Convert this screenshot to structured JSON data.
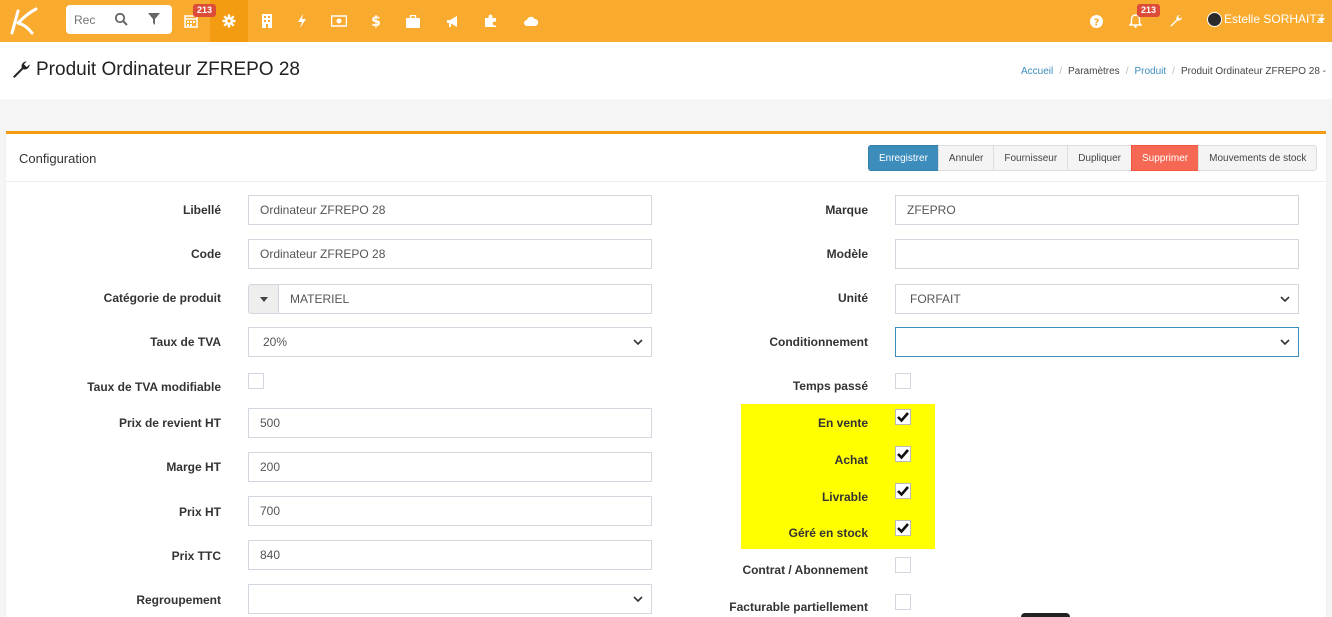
{
  "navbar": {
    "search_placeholder": "Rec",
    "calendar_badge": "213",
    "notifications_badge": "213",
    "user_name": "Estelle SORHAITZ",
    "colors": {
      "bar": "#f9ab2f",
      "active": "#f39c12",
      "badge": "#dd4b39"
    },
    "icons": [
      "logo-icon",
      "search-icon",
      "filter-icon",
      "calendar-icon",
      "gear-icon",
      "building-icon",
      "bolt-icon",
      "money-icon",
      "dollar-icon",
      "briefcase-icon",
      "megaphone-icon",
      "puzzle-icon",
      "cloud-icon",
      "help-icon",
      "bell-icon",
      "wrench-icon",
      "caret-down-icon"
    ]
  },
  "page": {
    "title": "Produit Ordinateur ZFREPO 28",
    "breadcrumb": {
      "home": "Accueil",
      "settings": "Paramètres",
      "product": "Produit",
      "current": "Produit Ordinateur ZFREPO 28 -"
    }
  },
  "box": {
    "title": "Configuration",
    "buttons": {
      "save": "Enregistrer",
      "cancel": "Annuler",
      "supplier": "Fournisseur",
      "duplicate": "Dupliquer",
      "delete": "Supprimer",
      "stock_moves": "Mouvements de stock"
    }
  },
  "form_left": {
    "libelle_label": "Libellé",
    "libelle_value": "Ordinateur ZFREPO 28",
    "code_label": "Code",
    "code_value": "Ordinateur ZFREPO 28",
    "category_label": "Catégorie de produit",
    "category_value": "MATERIEL",
    "vat_label": "Taux de TVA",
    "vat_value": "20%",
    "vat_editable_label": "Taux de TVA modifiable",
    "cost_label": "Prix de revient HT",
    "cost_value": "500",
    "margin_label": "Marge HT",
    "margin_value": "200",
    "price_label": "Prix HT",
    "price_value": "700",
    "price_ttc_label": "Prix TTC",
    "price_ttc_value": "840",
    "group_label": "Regroupement",
    "group_value": ""
  },
  "form_right": {
    "brand_label": "Marque",
    "brand_value": "ZFEPRO",
    "model_label": "Modèle",
    "model_value": "",
    "unit_label": "Unité",
    "unit_value": "FORFAIT",
    "packaging_label": "Conditionnement",
    "packaging_value": "",
    "time_label": "Temps passé",
    "sale_label": "En vente",
    "purchase_label": "Achat",
    "deliverable_label": "Livrable",
    "stock_label": "Géré en stock",
    "contract_label": "Contrat / Abonnement",
    "partial_label": "Facturable partiellement"
  },
  "checkbox_state": {
    "vat_editable": false,
    "time": false,
    "sale": true,
    "purchase": true,
    "deliverable": true,
    "stock": true,
    "contract": false,
    "partial": false
  },
  "highlight_color": "#ffff00"
}
